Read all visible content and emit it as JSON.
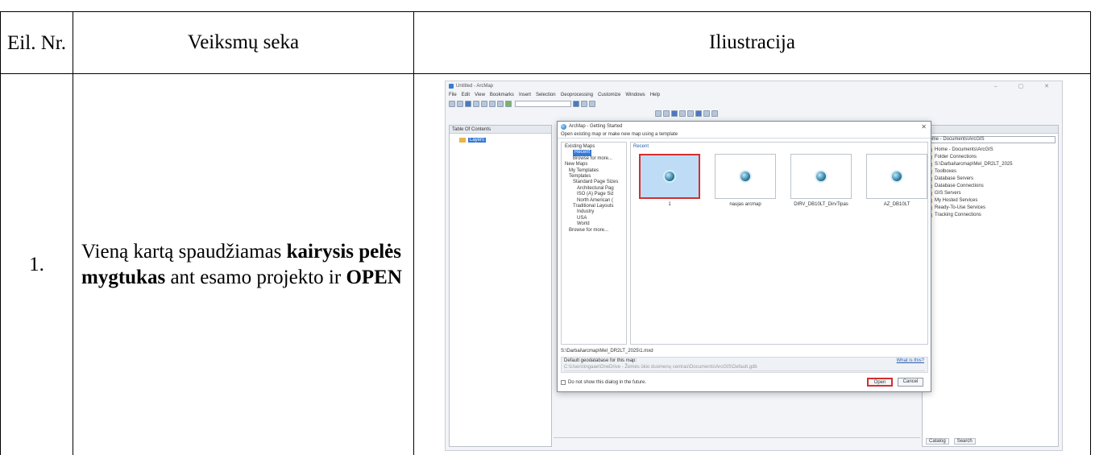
{
  "table": {
    "headers": {
      "nr": "Eil. Nr.",
      "steps": "Veiksmų seka",
      "illustration": "Iliustracija"
    },
    "rows": [
      {
        "nr": "1.",
        "step_parts": [
          {
            "text": "Vieną kartą spaudžiamas ",
            "bold": false
          },
          {
            "text": "kairysis pelės mygtukas",
            "bold": true
          },
          {
            "text": " ant esamo projekto ir ",
            "bold": false
          },
          {
            "text": "OPEN",
            "bold": true
          }
        ]
      }
    ]
  },
  "screenshot": {
    "window_title": "Untitled - ArcMap",
    "menu": [
      "File",
      "Edit",
      "View",
      "Bookmarks",
      "Insert",
      "Selection",
      "Geoprocessing",
      "Customize",
      "Windows",
      "Help"
    ],
    "toc_title": "Table Of Contents",
    "toc_layer": "Layers",
    "catalog": {
      "location": "Home - Documents\\ArcGIS",
      "items": [
        "Home - Documents\\ArcGIS",
        "Folder Connections",
        "S:\\Darbai\\arcmap\\Mel_DR2LT_2025",
        "Toolboxes",
        "Database Servers",
        "Database Connections",
        "GIS Servers",
        "My Hosted Services",
        "Ready-To-Use Services",
        "Tracking Connections"
      ],
      "tabs": [
        "Catalog",
        "Search"
      ]
    },
    "dialog": {
      "title": "ArcMap - Getting Started",
      "hint": "Open existing map or make new map using a template",
      "tree": [
        "Existing Maps",
        "Recent",
        "Browse for more...",
        "New Maps",
        "My Templates",
        "Templates",
        "Standard Page Sizes",
        "Architectural Pag",
        "ISO (A) Page Siz",
        "North American (",
        "Traditional Layouts",
        "Industry",
        "USA",
        "World",
        "Browse for more..."
      ],
      "recent_label": "Recent",
      "maps": [
        "1",
        "naujas arcmap",
        "DIRV_DB10LT_DirvTipas",
        "AZ_DB10LT"
      ],
      "path": "S:\\Darbai\\arcmap\\Mel_DR2LT_2025\\1.mxd",
      "gdb_label": "Default geodatabase for this map:",
      "gdb_link": "What is this?",
      "gdb_value": "C:\\Users\\ingaae\\OneDrive - Žemės ūkio duomenų centras\\Documents\\ArcGIS\\Default.gdb",
      "dont_show": "Do not show this dialog in the future.",
      "open_btn": "Open",
      "cancel_btn": "Cancel"
    }
  }
}
